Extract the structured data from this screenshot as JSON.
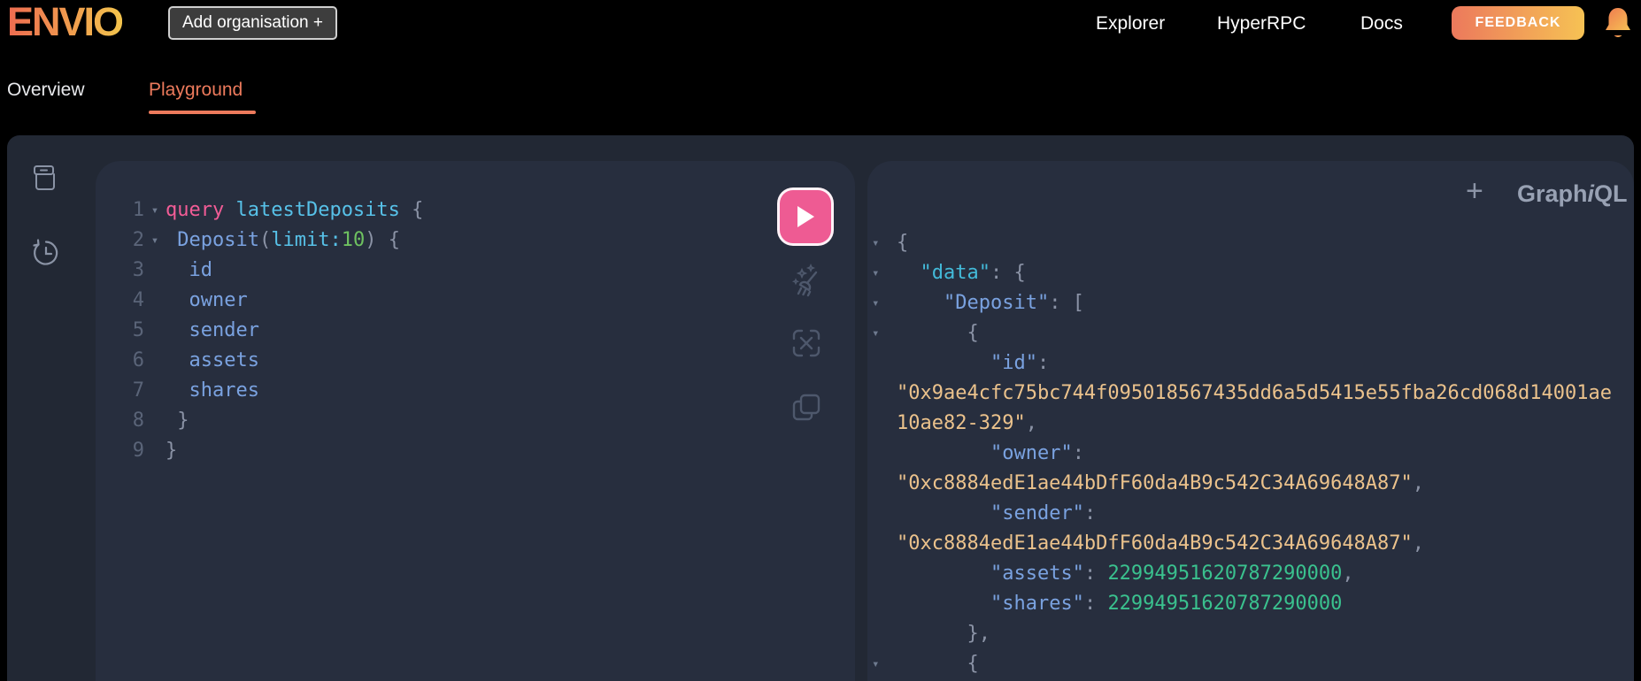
{
  "header": {
    "logo_text": "ENVIO",
    "add_organisation_button": "Add organisation +",
    "nav_items": [
      {
        "label": "Explorer"
      },
      {
        "label": "HyperRPC"
      },
      {
        "label": "Docs"
      }
    ],
    "feedback_button": "FEEDBACK",
    "bell_icon": "bell-icon"
  },
  "tabs": {
    "overview_label": "Overview",
    "playground_label": "Playground",
    "active_tab": "Playground"
  },
  "graphiql": {
    "plus_button": "+",
    "brand": {
      "graph": "Graph",
      "i": "i",
      "ql": "QL"
    },
    "sidebar_icons": [
      "docs-icon",
      "history-icon"
    ],
    "toolbar_icons": [
      "prettify-icon",
      "merge-icon",
      "copy-icon"
    ]
  },
  "query_editor": {
    "lines": [
      {
        "num": "1",
        "fold": true,
        "segments": [
          {
            "t": "query",
            "c": "kw"
          },
          {
            "t": " ",
            "c": "pln"
          },
          {
            "t": "latestDeposits",
            "c": "def"
          },
          {
            "t": " ",
            "c": "pln"
          },
          {
            "t": "{",
            "c": "pun"
          }
        ]
      },
      {
        "num": "2",
        "fold": true,
        "segments": [
          {
            "t": " ",
            "c": "pln"
          },
          {
            "t": "Deposit",
            "c": "fld"
          },
          {
            "t": "(",
            "c": "pun"
          },
          {
            "t": "limit",
            "c": "arg"
          },
          {
            "t": ":",
            "c": "arg"
          },
          {
            "t": "10",
            "c": "qnum"
          },
          {
            "t": ")",
            "c": "pun"
          },
          {
            "t": " ",
            "c": "pln"
          },
          {
            "t": "{",
            "c": "pun"
          }
        ]
      },
      {
        "num": "3",
        "fold": false,
        "segments": [
          {
            "t": "  ",
            "c": "pln"
          },
          {
            "t": "id",
            "c": "fld"
          }
        ]
      },
      {
        "num": "4",
        "fold": false,
        "segments": [
          {
            "t": "  ",
            "c": "pln"
          },
          {
            "t": "owner",
            "c": "fld"
          }
        ]
      },
      {
        "num": "5",
        "fold": false,
        "segments": [
          {
            "t": "  ",
            "c": "pln"
          },
          {
            "t": "sender",
            "c": "fld"
          }
        ]
      },
      {
        "num": "6",
        "fold": false,
        "segments": [
          {
            "t": "  ",
            "c": "pln"
          },
          {
            "t": "assets",
            "c": "fld"
          }
        ]
      },
      {
        "num": "7",
        "fold": false,
        "segments": [
          {
            "t": "  ",
            "c": "pln"
          },
          {
            "t": "shares",
            "c": "fld"
          }
        ]
      },
      {
        "num": "8",
        "fold": false,
        "segments": [
          {
            "t": " }",
            "c": "pun"
          }
        ]
      },
      {
        "num": "9",
        "fold": false,
        "segments": [
          {
            "t": "}",
            "c": "pun"
          }
        ]
      }
    ]
  },
  "response_viewer": {
    "record": {
      "id": "0x9ae4cfc75bc744f095018567435dd6a5d5415e55fba26cd068d14001ae10ae82-329",
      "owner": "0xc8884edE1ae44bDfF60da4B9c542C34A69648A87",
      "sender": "0xc8884edE1ae44bDfF60da4B9c542C34A69648A87",
      "assets": "22994951620787290000",
      "shares": "22994951620787290000"
    },
    "lines": [
      {
        "fold": true,
        "segments": [
          {
            "t": "{",
            "c": "pun"
          }
        ]
      },
      {
        "fold": true,
        "segments": [
          {
            "t": "  ",
            "c": "pln"
          },
          {
            "t": "\"data\"",
            "c": "rootkey"
          },
          {
            "t": ": {",
            "c": "pun"
          }
        ]
      },
      {
        "fold": true,
        "segments": [
          {
            "t": "    ",
            "c": "pln"
          },
          {
            "t": "\"Deposit\"",
            "c": "key"
          },
          {
            "t": ": [",
            "c": "pun"
          }
        ]
      },
      {
        "fold": true,
        "segments": [
          {
            "t": "      {",
            "c": "pun"
          }
        ]
      },
      {
        "fold": false,
        "segments": [
          {
            "t": "        ",
            "c": "pln"
          },
          {
            "t": "\"id\"",
            "c": "key"
          },
          {
            "t": ":",
            "c": "pun"
          }
        ]
      },
      {
        "fold": false,
        "segments": [
          {
            "t": "\"0x9ae4cfc75bc744f095018567435dd6a5d5415e55fba26cd068d14001ae",
            "c": "str"
          }
        ]
      },
      {
        "fold": false,
        "segments": [
          {
            "t": "10ae82-329\"",
            "c": "str"
          },
          {
            "t": ",",
            "c": "pun"
          }
        ]
      },
      {
        "fold": false,
        "segments": [
          {
            "t": "        ",
            "c": "pln"
          },
          {
            "t": "\"owner\"",
            "c": "key"
          },
          {
            "t": ":",
            "c": "pun"
          }
        ]
      },
      {
        "fold": false,
        "segments": [
          {
            "t": "\"0xc8884edE1ae44bDfF60da4B9c542C34A69648A87\"",
            "c": "str"
          },
          {
            "t": ",",
            "c": "pun"
          }
        ]
      },
      {
        "fold": false,
        "segments": [
          {
            "t": "        ",
            "c": "pln"
          },
          {
            "t": "\"sender\"",
            "c": "key"
          },
          {
            "t": ":",
            "c": "pun"
          }
        ]
      },
      {
        "fold": false,
        "segments": [
          {
            "t": "\"0xc8884edE1ae44bDfF60da4B9c542C34A69648A87\"",
            "c": "str"
          },
          {
            "t": ",",
            "c": "pun"
          }
        ]
      },
      {
        "fold": false,
        "segments": [
          {
            "t": "        ",
            "c": "pln"
          },
          {
            "t": "\"assets\"",
            "c": "key"
          },
          {
            "t": ": ",
            "c": "pun"
          },
          {
            "t": "22994951620787290000",
            "c": "rnum"
          },
          {
            "t": ",",
            "c": "pun"
          }
        ]
      },
      {
        "fold": false,
        "segments": [
          {
            "t": "        ",
            "c": "pln"
          },
          {
            "t": "\"shares\"",
            "c": "key"
          },
          {
            "t": ": ",
            "c": "pun"
          },
          {
            "t": "22994951620787290000",
            "c": "rnum"
          }
        ]
      },
      {
        "fold": false,
        "segments": [
          {
            "t": "      },",
            "c": "pun"
          }
        ]
      },
      {
        "fold": true,
        "segments": [
          {
            "t": "      {",
            "c": "pun"
          }
        ]
      }
    ]
  },
  "colors": {
    "accent_orange": "#ec7a5c",
    "logo_gradient_start": "#ed6b50",
    "logo_gradient_end": "#f3c44d",
    "feedback_gradient_start": "#ec795c",
    "feedback_gradient_end": "#f6c254",
    "container_bg": "#222834",
    "panel_bg": "#272e3e",
    "play_pink": "#ee5b93",
    "tok_kw": "#f25c96",
    "tok_def": "#57c1e8",
    "tok_fld": "#7aa2e0",
    "tok_arg": "#57c1e8",
    "tok_qnum": "#6ec160",
    "tok_pun": "#8b93a6",
    "tok_str": "#ebc28c",
    "tok_key": "#7aa2e0",
    "tok_rootkey": "#43bad9",
    "tok_rnum": "#3ac18e",
    "tok_ln": "#5a6478",
    "tok_fold": "#6e7a8f"
  }
}
